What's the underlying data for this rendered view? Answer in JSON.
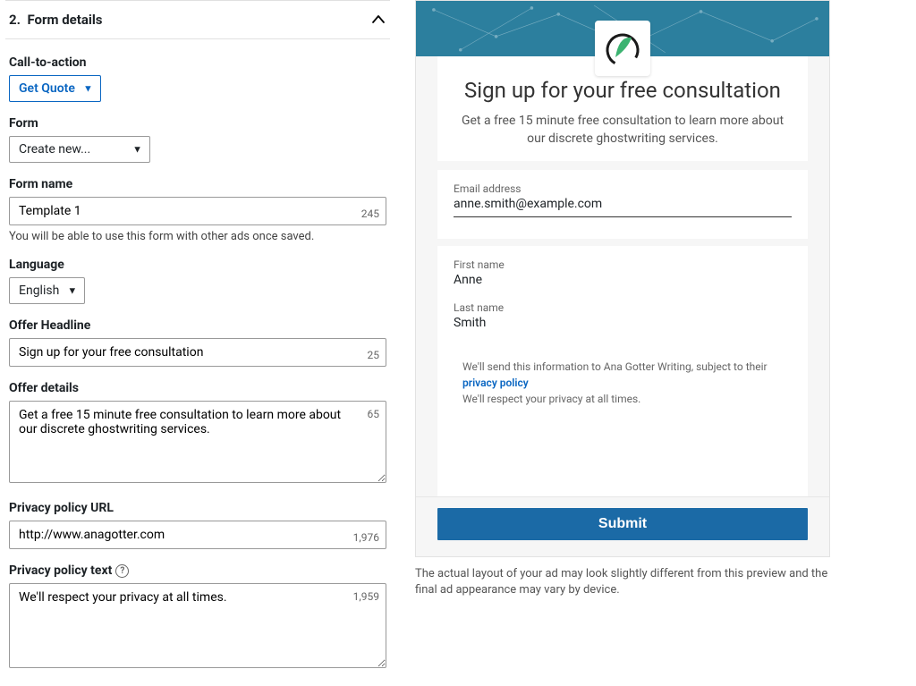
{
  "section": {
    "num": "2.",
    "title": "Form details"
  },
  "cta": {
    "label": "Call-to-action",
    "value": "Get Quote"
  },
  "form_select": {
    "label": "Form",
    "value": "Create new..."
  },
  "form_name": {
    "label": "Form name",
    "value": "Template 1",
    "counter": "245",
    "hint": "You will be able to use this form with other ads once saved."
  },
  "language": {
    "label": "Language",
    "value": "English"
  },
  "headline": {
    "label": "Offer Headline",
    "value": "Sign up for your free consultation",
    "counter": "25"
  },
  "details": {
    "label": "Offer details",
    "value": "Get a free 15 minute free consultation to learn more about our discrete ghostwriting services.",
    "counter": "65"
  },
  "privacy_url": {
    "label": "Privacy policy URL",
    "value": "http://www.anagotter.com",
    "counter": "1,976"
  },
  "privacy_text": {
    "label": "Privacy policy text",
    "value": "We'll respect your privacy at all times.",
    "counter": "1,959"
  },
  "preview": {
    "headline": "Sign up for your free consultation",
    "sub": "Get a free 15 minute free consultation to learn more about our discrete ghostwriting services.",
    "email_label": "Email address",
    "email_value": "anne.smith@example.com",
    "first_label": "First name",
    "first_value": "Anne",
    "last_label": "Last name",
    "last_value": "Smith",
    "consent_pre": "We'll send this information to Ana Gotter Writing, subject to their ",
    "consent_link": "privacy policy",
    "consent_custom": "We'll respect your privacy at all times.",
    "submit": "Submit"
  },
  "disclaimer": "The actual layout of your ad may look slightly different from this preview and the final ad appearance may vary by device."
}
